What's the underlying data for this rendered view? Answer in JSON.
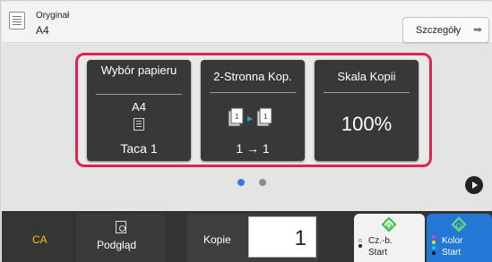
{
  "header": {
    "original_label": "Oryginał",
    "original_value": "A4",
    "details_label": "Szczegóły",
    "details_arrow": "➡"
  },
  "tiles": [
    {
      "title": "Wybór papieru",
      "value_top": "A4",
      "value_bottom": "Taca 1"
    },
    {
      "title": "2-Stronna Kop.",
      "value_bottom": "1 → 1"
    },
    {
      "title": "Skala Kopii",
      "value_center": "100%"
    }
  ],
  "pagination": {
    "total": 2,
    "active": 1
  },
  "bottom": {
    "ca_label": "CA",
    "preview_label": "Podgląd",
    "copies_label": "Kopie",
    "copies_value": "1",
    "bw_start_line1": "Cz.-b.",
    "bw_start_line2": "Start",
    "color_start_line1": "Kolor",
    "color_start_line2": "Start"
  },
  "colors": {
    "highlight": "#e0234e",
    "tile": "#383838",
    "active_dot": "#2f7de1",
    "ca_text": "#f7c100",
    "color_start_bg": "#2577d6",
    "start_icon": "#35c13d"
  },
  "icons": [
    "original-document-icon",
    "arrow-right-icon",
    "tray-icon",
    "duplex-copy-icon",
    "next-page-icon",
    "preview-icon",
    "start-diamond-icon"
  ]
}
